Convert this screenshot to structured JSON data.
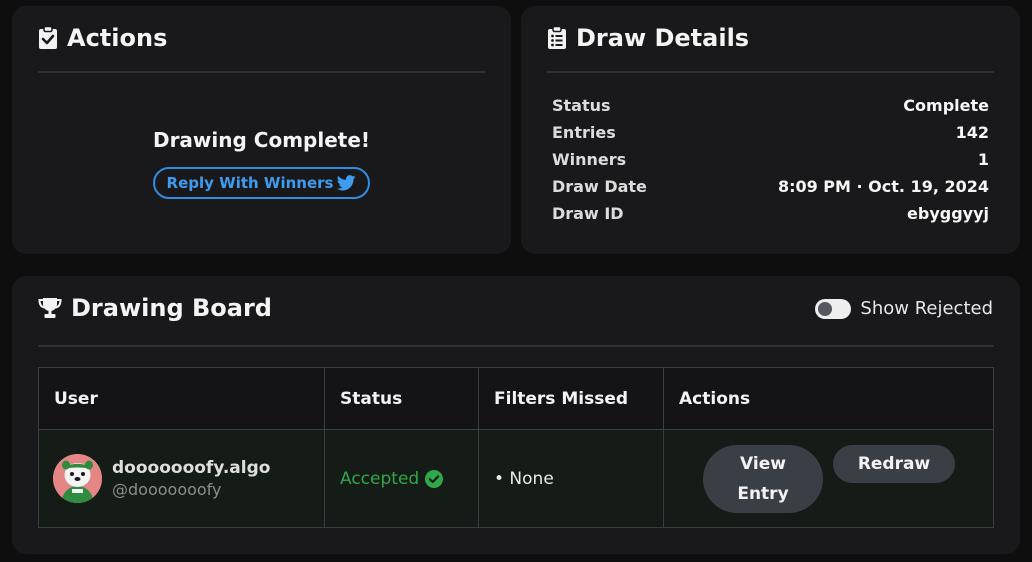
{
  "actions_card": {
    "title": "Actions",
    "icon": "clipboard-check-icon",
    "message": "Drawing Complete!",
    "reply_button_label": "Reply With Winners",
    "reply_icon": "twitter-icon"
  },
  "details_card": {
    "title": "Draw Details",
    "icon": "clipboard-list-icon",
    "rows": [
      {
        "label": "Status",
        "value": "Complete"
      },
      {
        "label": "Entries",
        "value": "142"
      },
      {
        "label": "Winners",
        "value": "1"
      },
      {
        "label": "Draw Date",
        "value": "8:09 PM · Oct. 19, 2024"
      },
      {
        "label": "Draw ID",
        "value": "ebyggyyj"
      }
    ]
  },
  "board": {
    "title": "Drawing Board",
    "icon": "trophy-icon",
    "toggle_label": "Show Rejected",
    "toggle_on": false,
    "columns": [
      "User",
      "Status",
      "Filters Missed",
      "Actions"
    ],
    "rows": [
      {
        "user_name": "dooooooofy.algo",
        "user_handle": "@dooooooofy",
        "status": "Accepted",
        "filters_missed": "• None",
        "view_label_line1": "View",
        "view_label_line2": "Entry",
        "redraw_label": "Redraw"
      }
    ]
  },
  "colors": {
    "background": "#0e0e0f",
    "card": "#19191b",
    "accent_blue": "#2f8ee2",
    "accepted_green": "#2fa84a",
    "button": "#3a3f46"
  }
}
